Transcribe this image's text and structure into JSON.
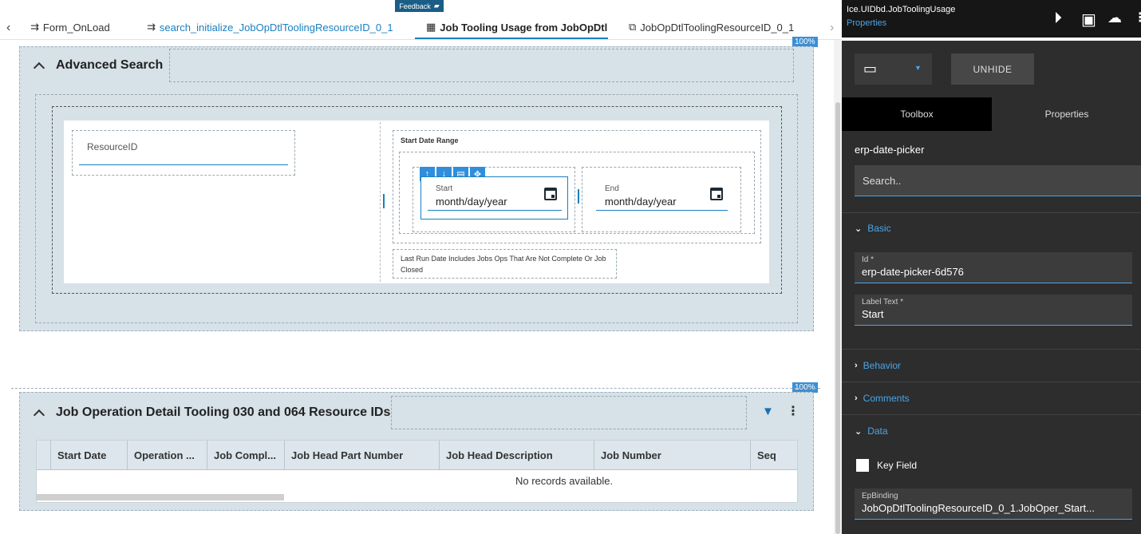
{
  "tabbar": {
    "feedback_label": "Feedback",
    "tabs": [
      {
        "label": "Form_OnLoad"
      },
      {
        "label": "search_initialize_JobOpDtlToolingResourceID_0_1"
      },
      {
        "label": "Job Tooling Usage from JobOpDtl"
      },
      {
        "label": "JobOpDtlToolingResourceID_0_1"
      }
    ]
  },
  "advanced_search": {
    "title": "Advanced Search",
    "percent_badge": "100%",
    "resource_label": "ResourceID",
    "date_range_title": "Start Date Range",
    "start": {
      "label": "Start",
      "placeholder": "month/day/year"
    },
    "end": {
      "label": "End",
      "placeholder": "month/day/year"
    },
    "note": "Last Run Date Includes Jobs Ops That Are Not Complete Or Job Closed"
  },
  "job_panel": {
    "title": "Job Operation Detail Tooling 030 and 064 Resource IDs",
    "percent_badge": "100%",
    "columns": [
      "Start Date",
      "Operation ...",
      "Job Compl...",
      "Job Head Part Number",
      "Job Head Description",
      "Job Number",
      "Seq"
    ],
    "empty_text": "No records available."
  },
  "right_panel": {
    "title": "Ice.UIDbd.JobToolingUsage",
    "subtitle": "Properties",
    "unhide_label": "UNHIDE",
    "tab_toolbox": "Toolbox",
    "tab_properties": "Properties",
    "component_name": "erp-date-picker",
    "search_placeholder": "Search..",
    "sections": {
      "basic": "Basic",
      "behavior": "Behavior",
      "comments": "Comments",
      "data": "Data"
    },
    "fields": {
      "id_label": "Id *",
      "id_value": "erp-date-picker-6d576",
      "label_text_label": "Label Text *",
      "label_text_value": "Start",
      "key_field_label": "Key Field",
      "key_field_checked": false,
      "ep_binding_label": "EpBinding",
      "ep_binding_value": "JobOpDtlToolingResourceID_0_1.JobOper_Start..."
    }
  },
  "colors": {
    "accent": "#1a7fc1",
    "panel_bg": "#d6e1e8",
    "dark_bg": "#2d2d2d",
    "link_blue": "#49a6e8"
  }
}
